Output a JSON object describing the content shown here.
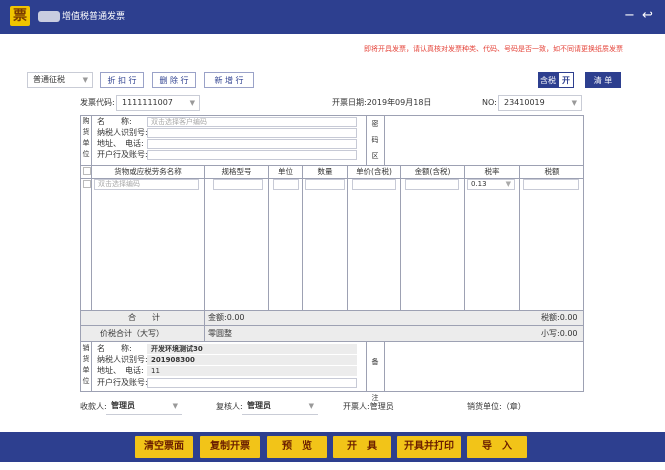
{
  "window": {
    "title": "增值税普通发票",
    "logo_char": "票",
    "minimize_icon": "−",
    "back_icon": "↩"
  },
  "notice": "即将开具发票，请认真核对发票种类、代码、号码是否一致，如不同请更换纸质发票",
  "toolbar": {
    "tax_type": "普通征税",
    "btn_discount": "折 扣 行",
    "btn_delete": "删 除 行",
    "btn_add": "新 增 行",
    "tax_incl_label": "含税",
    "tax_incl_state": "开",
    "btn_list": "清 单"
  },
  "header": {
    "code_label": "发票代码:",
    "code_value": "1111111007",
    "date_label": "开票日期:",
    "date_value": "2019年09月18日",
    "no_label": "NO:",
    "no_value": "23410019"
  },
  "buyer": {
    "side": [
      "购",
      "货",
      "单",
      "位"
    ],
    "name_label": "名　　称:",
    "name_placeholder": "双击选择客户编码",
    "taxid_label": "纳税人识别号:",
    "addr_label": "地址、　电话:",
    "bank_label": "开户行及账号:",
    "secret": [
      "密",
      "码",
      "区"
    ]
  },
  "items": {
    "headers": [
      "货物或应税劳务名称",
      "规格型号",
      "单位",
      "数量",
      "单价(含税)",
      "金额(含税)",
      "税率",
      "税额"
    ],
    "name_placeholder": "双击选择编码",
    "rate_value": "0.13"
  },
  "totals": {
    "sum_label": "合　　计",
    "amount": "金额:0.00",
    "tax": "税额:0.00",
    "total_label": "价税合计（大写）",
    "total_caps": "零圆整",
    "small": "小写:0.00"
  },
  "seller": {
    "side": [
      "销",
      "货",
      "单",
      "位"
    ],
    "name_label": "名　　称:",
    "name_value": "开发环境测试30",
    "taxid_label": "纳税人识别号:",
    "taxid_value": "201908300",
    "addr_label": "地址、　电话:",
    "addr_value": "11",
    "bank_label": "开户行及账号:",
    "remark": [
      "备",
      "注"
    ]
  },
  "footer": {
    "payee_label": "收款人:",
    "payee_value": "管理员",
    "reviewer_label": "复核人:",
    "reviewer_value": "管理员",
    "issuer_label": "开票人:",
    "issuer_value": "管理员",
    "seller_unit_label": "销货单位:（章）"
  },
  "actions": [
    "清空票面",
    "复制开票",
    "预　览",
    "开　具",
    "开具并打印",
    "导　入"
  ]
}
